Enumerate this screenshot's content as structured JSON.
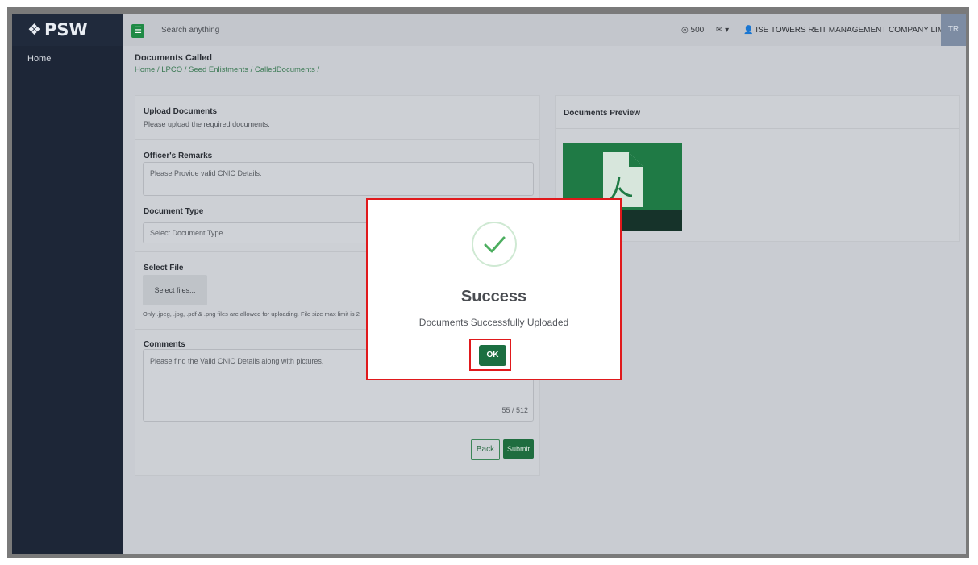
{
  "brand": {
    "logo": "PSW",
    "logo_mark": "❖"
  },
  "sidebar": {
    "items": [
      {
        "label": "Home"
      }
    ]
  },
  "topbar": {
    "menu_icon": "hamburger-menu-icon",
    "search_placeholder": "Search anything",
    "coins": "500",
    "company": "ISE TOWERS REIT MANAGEMENT COMPANY LIMITED",
    "avatar": "TR"
  },
  "page": {
    "title": "Documents Called",
    "breadcrumb": "Home / LPCO / Seed Enlistments / CalledDocuments /"
  },
  "upload": {
    "title": "Upload Documents",
    "subtitle": "Please upload the required documents.",
    "remarks_label": "Officer's Remarks",
    "remarks_value": "Please Provide valid CNIC Details.",
    "doc_type_label": "Document Type",
    "doc_type_placeholder": "Select Document Type",
    "select_file_label": "Select File",
    "select_files_button": "Select files...",
    "file_hint": "Only .jpeg, .jpg, .pdf & .png files are allowed for uploading. File size max limit is 2",
    "comments_label": "Comments",
    "comments_value": "Please find the Valid CNIC Details along with pictures.",
    "char_count": "55 / 512",
    "back_label": "Back",
    "submit_label": "Submit"
  },
  "preview": {
    "title": "Documents Preview"
  },
  "modal": {
    "title": "Success",
    "message": "Documents Successfully Uploaded",
    "ok_label": "OK"
  },
  "colors": {
    "accent": "#1f7a45",
    "highlight": "#e0191c",
    "sidebar": "#1d2637"
  }
}
